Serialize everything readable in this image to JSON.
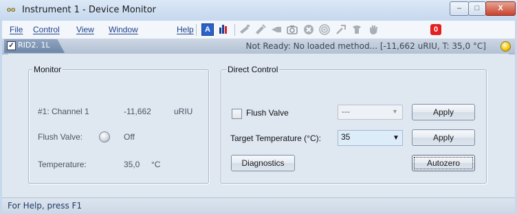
{
  "window": {
    "title": "Instrument 1 - Device Monitor",
    "app_icon": "oo",
    "controls": {
      "minimize": "–",
      "maximize": "□",
      "close": "X"
    }
  },
  "menu": {
    "items": [
      {
        "label": "File"
      },
      {
        "label": "Control"
      },
      {
        "label": "View"
      },
      {
        "label": "Window"
      },
      {
        "label": "Help"
      }
    ]
  },
  "toolbar": {
    "icons": [
      "method-a-icon",
      "signal-bars-icon",
      "inject-icon",
      "syringe-icon",
      "valve-icon",
      "camera-icon",
      "cancel-icon",
      "target-icon",
      "wrench-icon",
      "tool-icon",
      "hand-icon",
      "stop-icon"
    ],
    "stop_glyph": "0",
    "a_glyph": "A"
  },
  "module": {
    "name": "RID2. 1L",
    "checked": true,
    "status": "Not Ready: No loaded method...  [-11,662 uRIU, T: 35,0 °C]",
    "status_color": "#f5c400"
  },
  "monitor": {
    "legend": "Monitor",
    "channel_label": "#1: Channel 1",
    "channel_value": "-11,662",
    "channel_unit": "uRIU",
    "flush_label": "Flush Valve:",
    "flush_value": "Off",
    "temp_label": "Temperature:",
    "temp_value": "35,0",
    "temp_unit": "°C"
  },
  "direct": {
    "legend": "Direct Control",
    "flush_label": "Flush Valve",
    "flush_select": "---",
    "apply1": "Apply",
    "temp_label": "Target Temperature (°C):",
    "temp_value": "35",
    "apply2": "Apply",
    "diagnostics": "Diagnostics",
    "autozero": "Autozero"
  },
  "statusbar": {
    "text": "For Help, press F1"
  }
}
